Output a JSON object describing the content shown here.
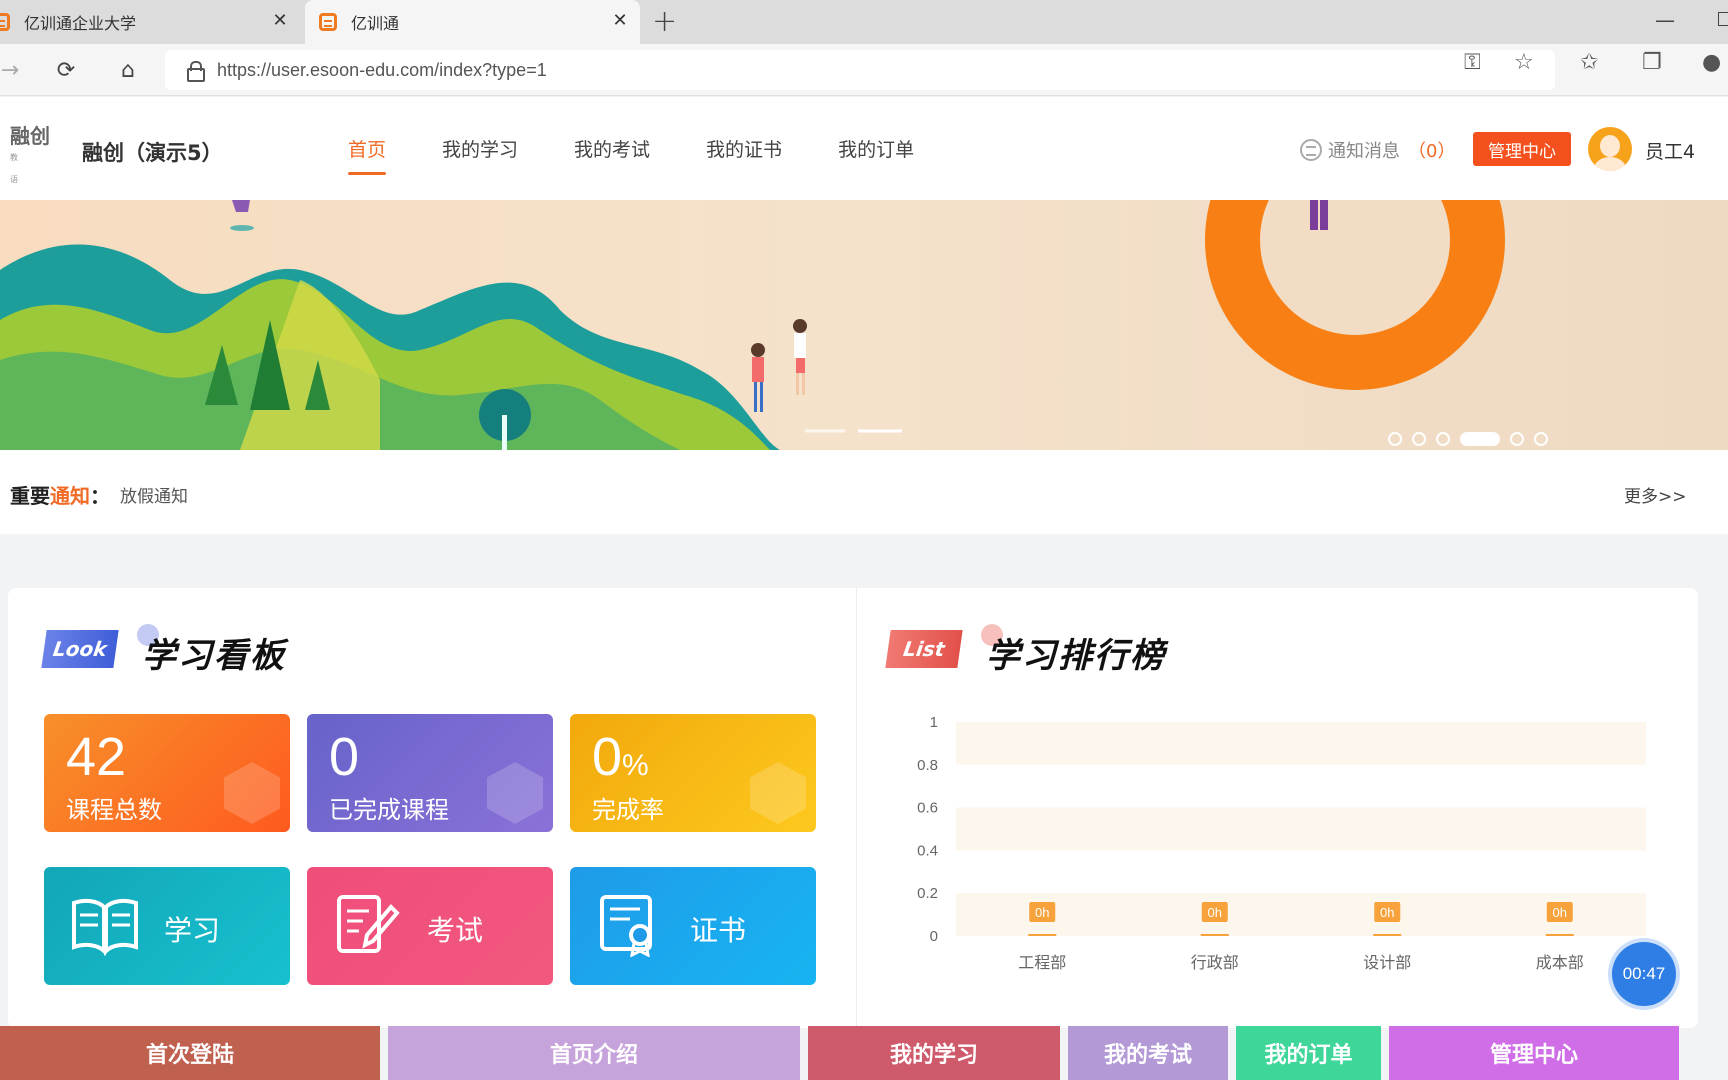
{
  "browser": {
    "tabs": [
      {
        "title": "亿训通企业大学"
      },
      {
        "title": "亿训通"
      }
    ],
    "url": "https://user.esoon-edu.com/index?type=1"
  },
  "header": {
    "logo_text": "融创",
    "logo_sub": "教 语",
    "brand_name": "融创（演示5）",
    "nav": [
      "首页",
      "我的学习",
      "我的考试",
      "我的证书",
      "我的订单"
    ],
    "notice_label": "通知消息",
    "notice_count": "（0）",
    "admin_label": "管理中心",
    "user_name": "员工4"
  },
  "banner": {
    "dot_count": 6,
    "active_dot": 3
  },
  "notice": {
    "title_a": "重要",
    "title_b": "通知",
    "title_colon": "：",
    "text": "放假通知",
    "more": "更多>>"
  },
  "board": {
    "badge": "Look",
    "title": "学习看板",
    "stats": [
      {
        "value": "42",
        "unit": "",
        "label": "课程总数"
      },
      {
        "value": "0",
        "unit": "",
        "label": "已完成课程"
      },
      {
        "value": "0",
        "unit": "%",
        "label": "完成率"
      }
    ],
    "tiles": [
      {
        "label": "学习",
        "icon": "book-icon"
      },
      {
        "label": "考试",
        "icon": "exam-icon"
      },
      {
        "label": "证书",
        "icon": "certificate-icon"
      }
    ]
  },
  "ranking": {
    "badge": "List",
    "title": "学习排行榜"
  },
  "chart_data": {
    "type": "bar",
    "categories": [
      "工程部",
      "行政部",
      "设计部",
      "成本部"
    ],
    "values": [
      0,
      0,
      0,
      0
    ],
    "data_labels": [
      "0h",
      "0h",
      "0h",
      "0h"
    ],
    "yticks": [
      "0",
      "0.2",
      "0.4",
      "0.6",
      "0.8",
      "1"
    ],
    "ylim": [
      0,
      1
    ],
    "title": "",
    "xlabel": "",
    "ylabel": ""
  },
  "timer": "00:47",
  "bottom_bar": [
    {
      "label": "首次登陆",
      "color": "#c0604f"
    },
    {
      "label": "首页介绍",
      "color": "#c7a3dc"
    },
    {
      "label": "我的学习",
      "color": "#cf5a6c"
    },
    {
      "label": "我的考试",
      "color": "#b39ad6"
    },
    {
      "label": "我的订单",
      "color": "#3fd69a"
    },
    {
      "label": "管理中心",
      "color": "#cf6ee6"
    }
  ],
  "colors": {
    "accent": "#f06b25",
    "admin_button": "#f4511e"
  }
}
